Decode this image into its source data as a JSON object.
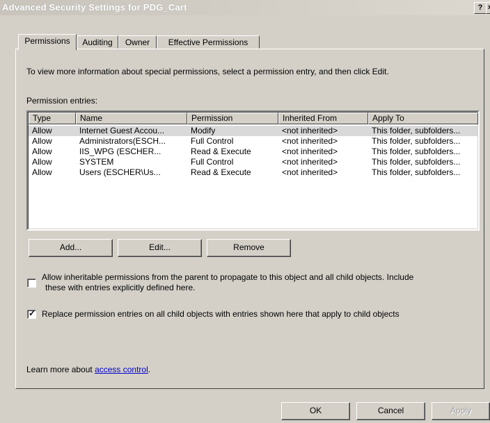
{
  "window": {
    "title": "Advanced Security Settings for PDG_Cart",
    "help_btn": "?",
    "close_btn": "×"
  },
  "tabs": [
    {
      "label": "Permissions"
    },
    {
      "label": "Auditing"
    },
    {
      "label": "Owner"
    },
    {
      "label": "Effective Permissions"
    }
  ],
  "permissions": {
    "intro": "To view more information about special permissions, select a permission entry, and then click Edit.",
    "entries_label": "Permission entries:",
    "columns": [
      "Type",
      "Name",
      "Permission",
      "Inherited From",
      "Apply To"
    ],
    "rows": [
      [
        "Allow",
        "Internet Guest Accou...",
        "Modify",
        "<not inherited>",
        "This folder, subfolders..."
      ],
      [
        "Allow",
        "Administrators(ESCH...",
        "Full Control",
        "<not inherited>",
        "This folder, subfolders..."
      ],
      [
        "Allow",
        "IIS_WPG (ESCHER...",
        "Read & Execute",
        "<not inherited>",
        "This folder, subfolders..."
      ],
      [
        "Allow",
        "SYSTEM",
        "Full Control",
        "<not inherited>",
        "This folder, subfolders..."
      ],
      [
        "Allow",
        "Users (ESCHER\\Us...",
        "Read & Execute",
        "<not inherited>",
        "This folder, subfolders..."
      ]
    ],
    "add_btn": "Add...",
    "edit_btn": "Edit...",
    "remove_btn": "Remove",
    "inherit_checkbox": {
      "checked": false,
      "line1": "Allow inheritable permissions from the parent to propagate to this object and all child objects. Include",
      "line2": "these with entries explicitly defined here."
    },
    "replace_checkbox": {
      "checked": true,
      "label": "Replace permission entries on all child objects with entries shown here that apply to child objects"
    },
    "learn_more_prefix": "Learn more about ",
    "learn_more_link": "access control",
    "learn_more_suffix": "."
  },
  "footer": {
    "ok": "OK",
    "cancel": "Cancel",
    "apply": "Apply"
  }
}
